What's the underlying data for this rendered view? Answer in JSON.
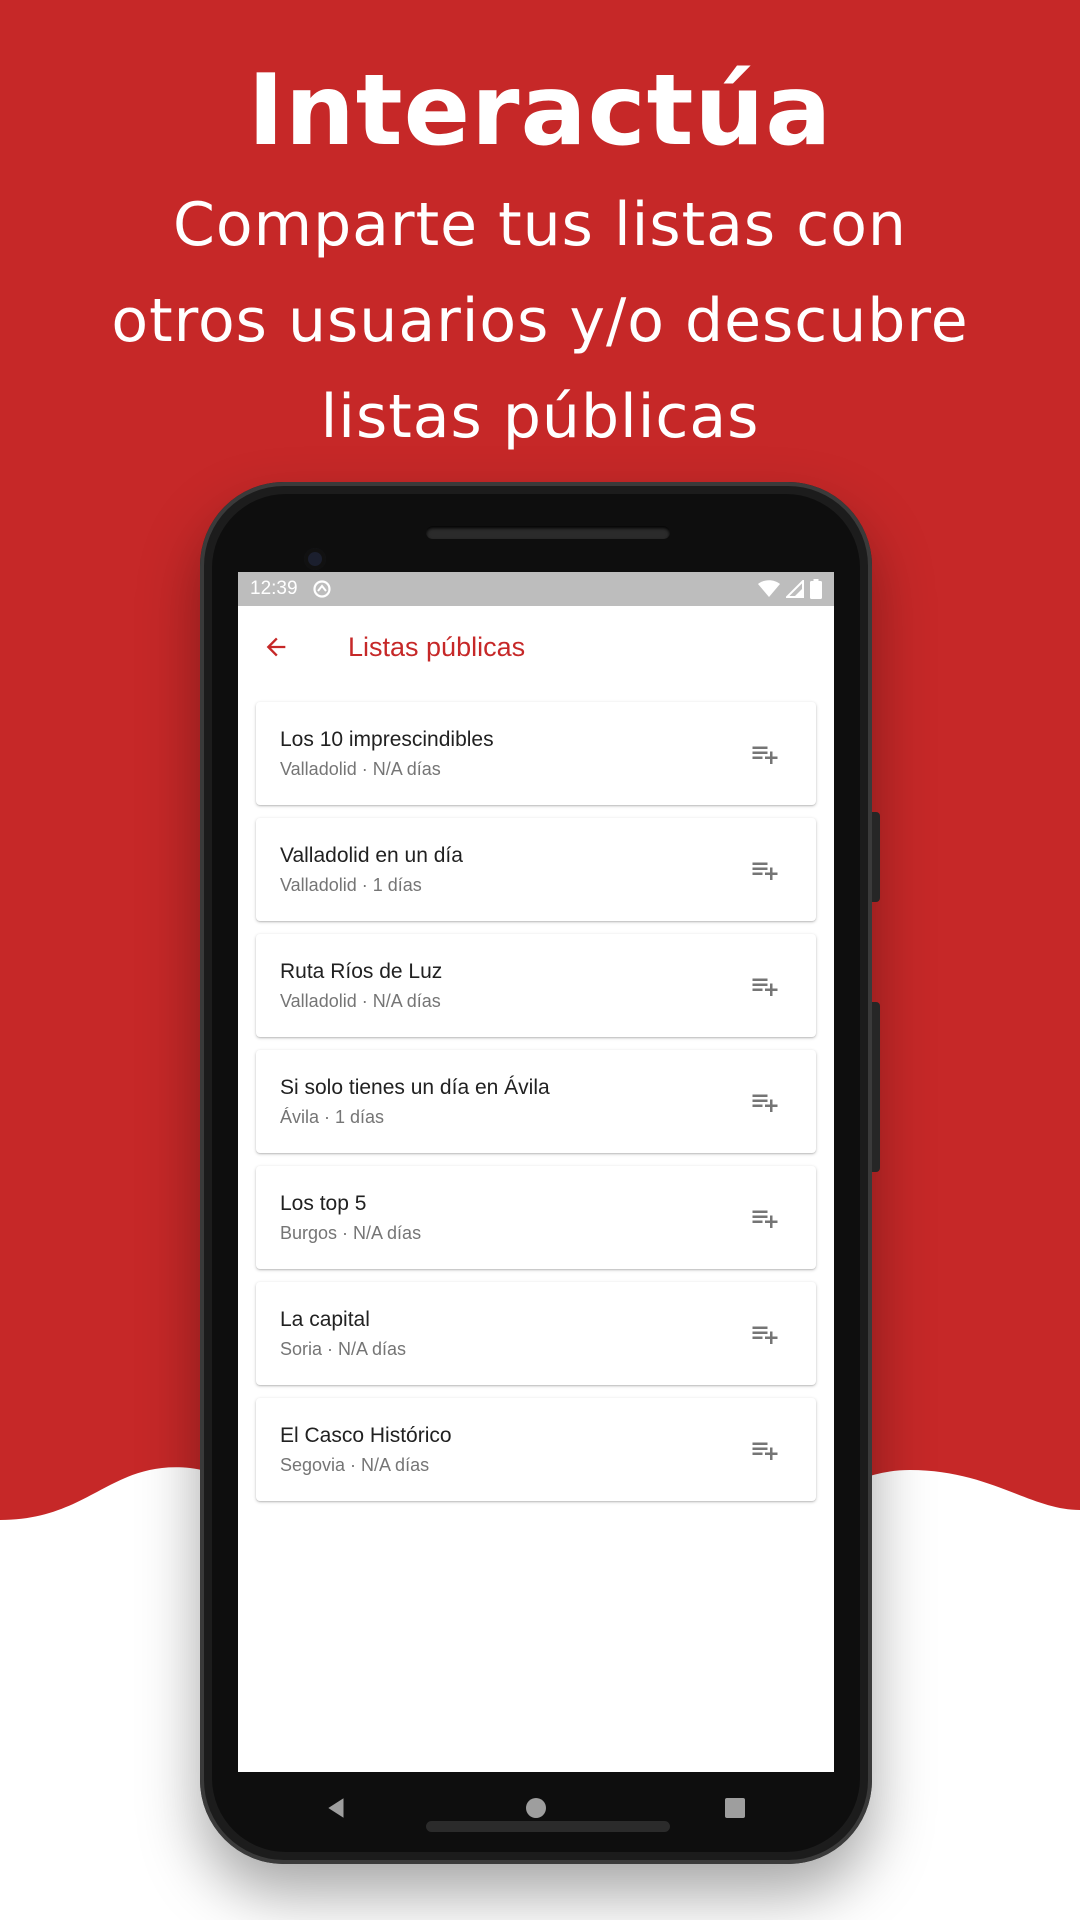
{
  "promo": {
    "title": "Interactúa",
    "subtitle_lines": [
      "Comparte tus listas con",
      "otros usuarios y/o descubre",
      "listas públicas"
    ]
  },
  "statusbar": {
    "time": "12:39"
  },
  "appbar": {
    "title": "Listas públicas",
    "back_icon": "arrow-back-icon"
  },
  "lists": [
    {
      "name": "Los 10 imprescindibles",
      "meta": "Valladolid · N/A días"
    },
    {
      "name": "Valladolid en un día",
      "meta": "Valladolid · 1 días"
    },
    {
      "name": "Ruta Ríos de Luz",
      "meta": "Valladolid · N/A días"
    },
    {
      "name": "Si solo tienes un día en Ávila",
      "meta": "Ávila · 1 días"
    },
    {
      "name": "Los top 5",
      "meta": "Burgos · N/A días"
    },
    {
      "name": "La capital",
      "meta": "Soria · N/A días"
    },
    {
      "name": "El Casco Histórico",
      "meta": "Segovia · N/A días"
    }
  ],
  "colors": {
    "brand": "#c62828",
    "statusbar": "#bdbdbd"
  }
}
